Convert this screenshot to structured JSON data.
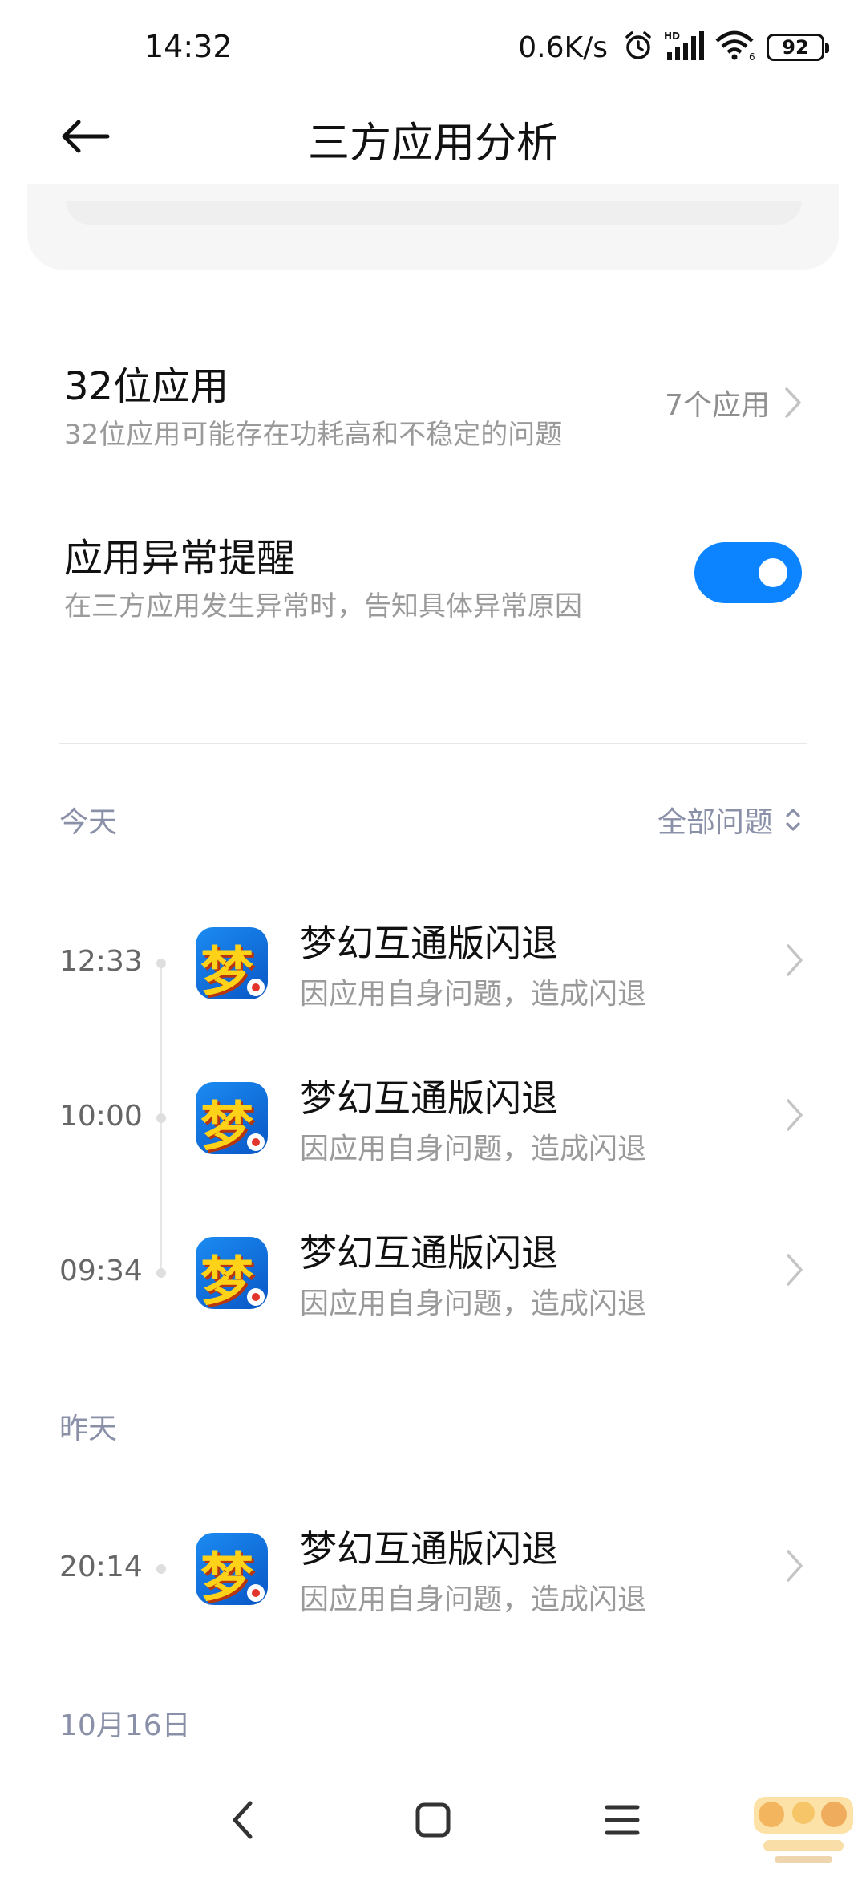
{
  "status_bar": {
    "time": "14:32",
    "net_speed": "0.6K/s",
    "battery": "92",
    "icons": [
      "alarm-icon",
      "hd-signal-icon",
      "wifi-icon",
      "battery-icon"
    ]
  },
  "header": {
    "title": "三方应用分析",
    "back_icon": "arrow-left-icon"
  },
  "settings": {
    "apps32": {
      "title": "32位应用",
      "description": "32位应用可能存在功耗高和不稳定的问题",
      "count": "7个应用"
    },
    "abnormal_alert": {
      "title": "应用异常提醒",
      "description": "在三方应用发生异常时，告知具体异常原因",
      "enabled": true
    }
  },
  "filter": {
    "label": "全部问题"
  },
  "sections": [
    {
      "label": "今天",
      "events": [
        {
          "time": "12:33",
          "title": "梦幻互通版闪退",
          "subtitle": "因应用自身问题，造成闪退"
        },
        {
          "time": "10:00",
          "title": "梦幻互通版闪退",
          "subtitle": "因应用自身问题，造成闪退"
        },
        {
          "time": "09:34",
          "title": "梦幻互通版闪退",
          "subtitle": "因应用自身问题，造成闪退"
        }
      ]
    },
    {
      "label": "昨天",
      "events": [
        {
          "time": "20:14",
          "title": "梦幻互通版闪退",
          "subtitle": "因应用自身问题，造成闪退"
        }
      ]
    },
    {
      "label": "10月16日",
      "events": []
    }
  ],
  "app_icon_glyph": "梦",
  "colors": {
    "accent": "#0d84ff",
    "secondary_text": "#9a9a9a",
    "section_label": "#8a90a8"
  }
}
